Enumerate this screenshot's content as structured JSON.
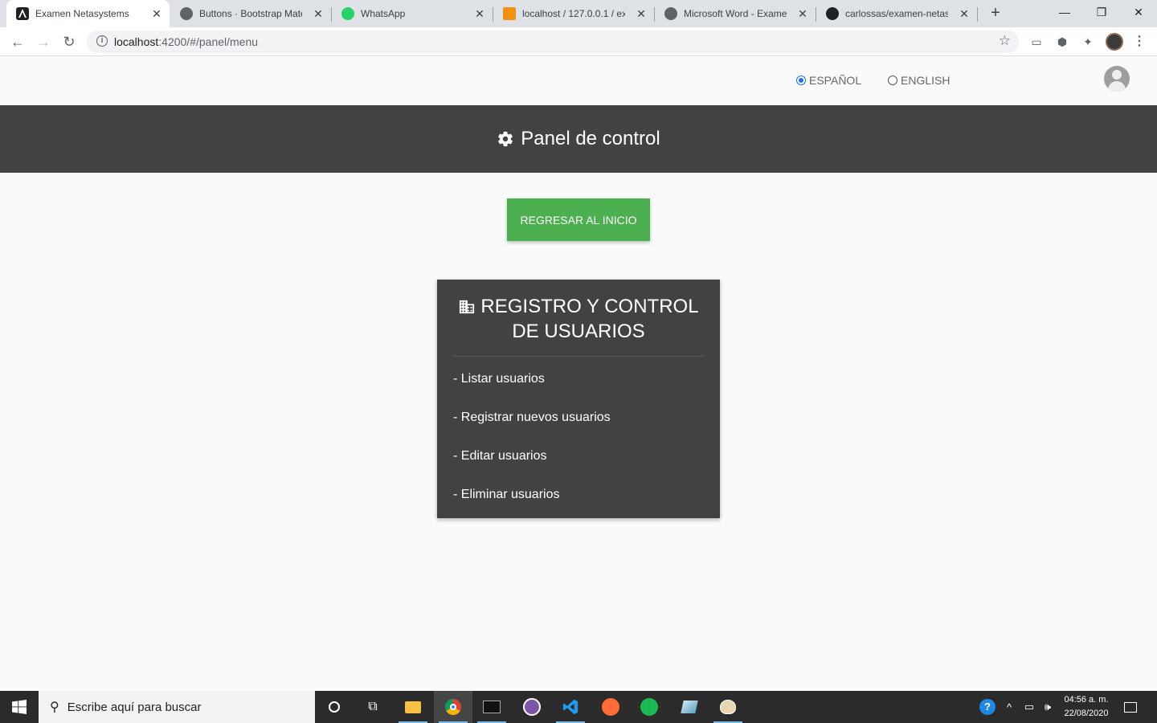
{
  "browser": {
    "tabs": [
      {
        "title": "Examen Netasystems",
        "active": true
      },
      {
        "title": "Buttons · Bootstrap Mater",
        "active": false
      },
      {
        "title": "WhatsApp",
        "active": false
      },
      {
        "title": "localhost / 127.0.0.1 / exa",
        "active": false
      },
      {
        "title": "Microsoft Word - Examen",
        "active": false
      },
      {
        "title": "carlossas/examen-netasys",
        "active": false
      }
    ],
    "url_host": "localhost",
    "url_path": ":4200/#/panel/menu"
  },
  "language": {
    "options": [
      {
        "label": "ESPAÑOL",
        "selected": true
      },
      {
        "label": "ENGLISH",
        "selected": false
      }
    ]
  },
  "banner": {
    "title": "Panel de control"
  },
  "home_button": {
    "label": "REGRESAR AL INICIO"
  },
  "card": {
    "title_line1": "REGISTRO Y CONTROL",
    "title_line2": "DE USUARIOS",
    "items": [
      {
        "label": "- Listar usuarios"
      },
      {
        "label": "- Registrar nuevos usuarios"
      },
      {
        "label": "- Editar usuarios"
      },
      {
        "label": "- Eliminar usuarios"
      }
    ]
  },
  "taskbar": {
    "search_placeholder": "Escribe aquí para buscar",
    "time": "04:56 a. m.",
    "date": "22/08/2020"
  },
  "colors": {
    "banner_bg": "#424242",
    "card_bg": "#424242",
    "button_green": "#4caf50",
    "page_bg": "#fafafa",
    "radio_accent": "#1a73e8"
  }
}
